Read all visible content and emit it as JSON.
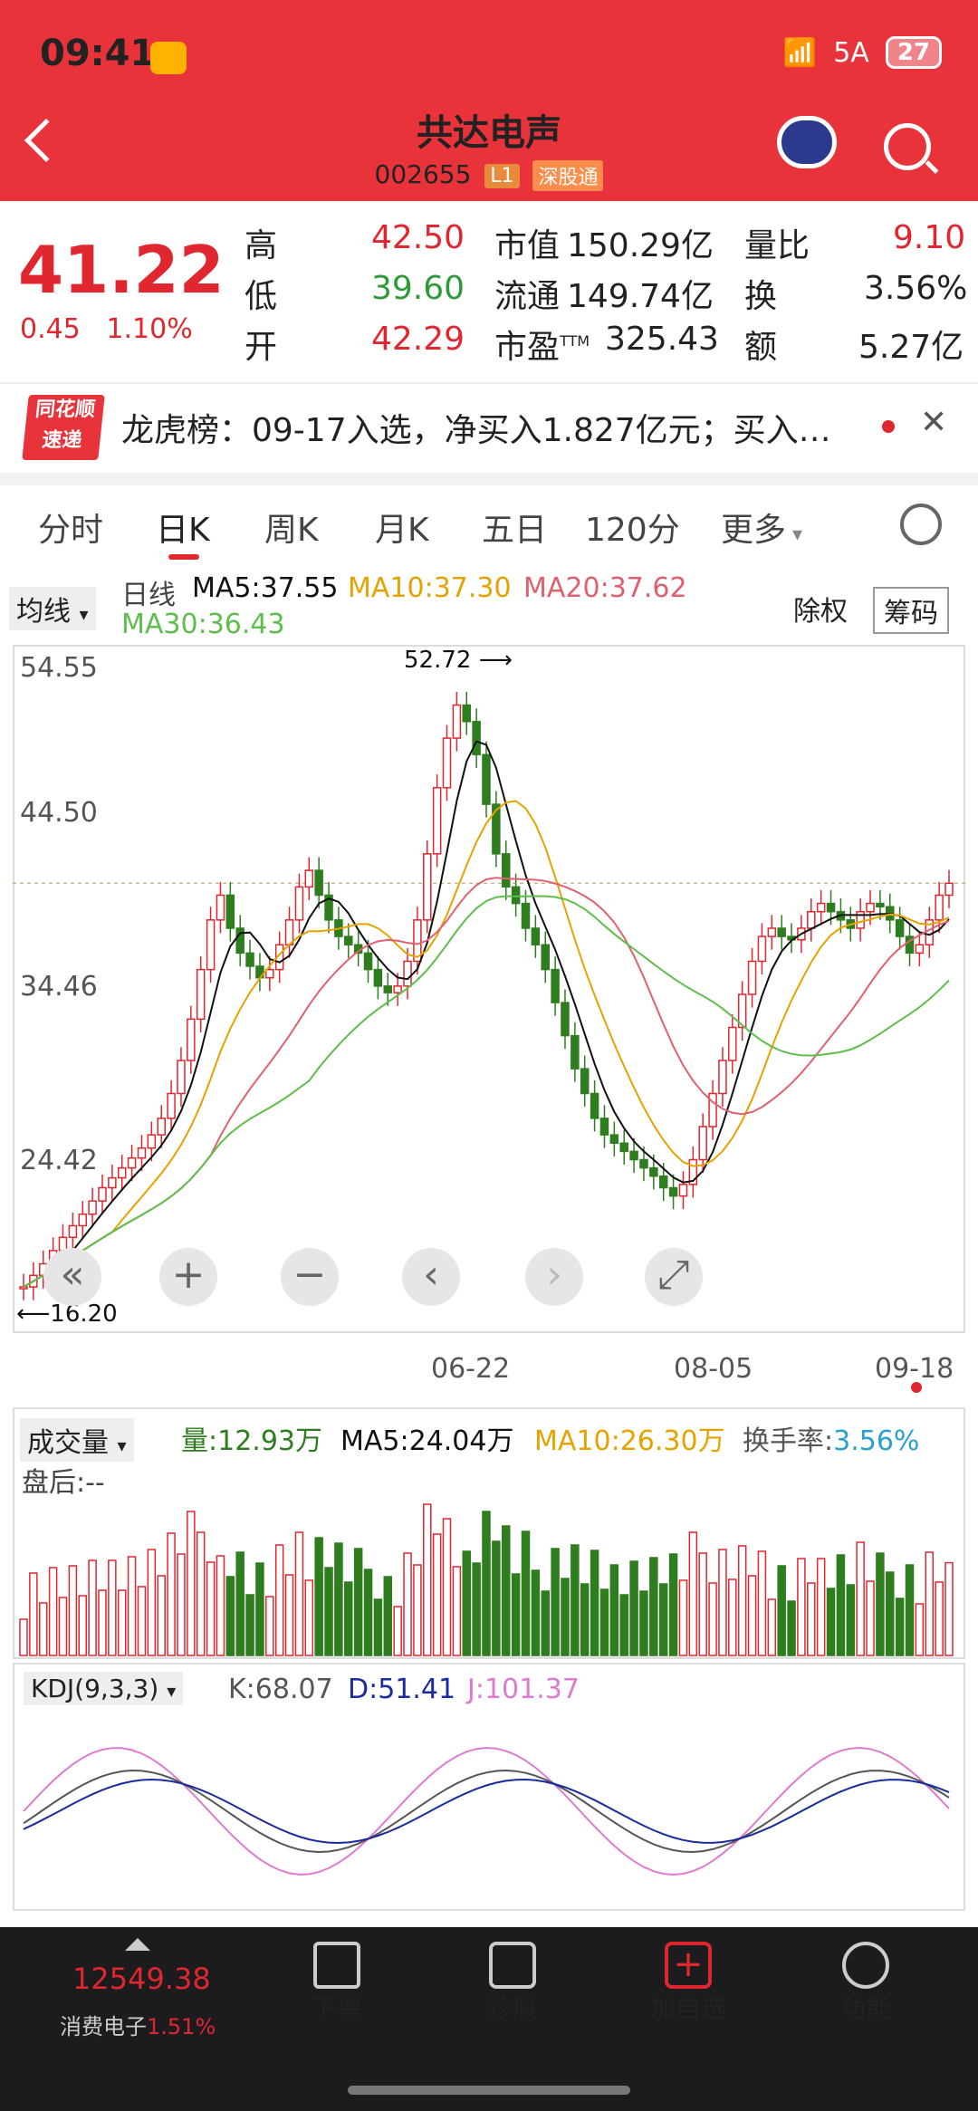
{
  "status": {
    "time": "09:41",
    "battery": "27",
    "signal": "5A"
  },
  "header": {
    "title": "共达电声",
    "code": "002655",
    "level_tag": "L1",
    "market_tag": "深股通"
  },
  "quote": {
    "price": "41.22",
    "change": "0.45",
    "change_pct": "1.10%",
    "high_label": "高",
    "high": "42.50",
    "low_label": "低",
    "low": "39.60",
    "open_label": "开",
    "open": "42.29",
    "mcap_label": "市值",
    "mcap": "150.29亿",
    "float_label": "流通",
    "float": "149.74亿",
    "pe_label": "市盈",
    "pe_sup": "TTM",
    "pe": "325.43",
    "vr_label": "量比",
    "vr": "9.10",
    "turn_label": "换",
    "turn": "3.56%",
    "amt_label": "额",
    "amt": "5.27亿"
  },
  "news": {
    "logo_top": "同花顺",
    "logo_bottom": "速递",
    "text": "龙虎榜：09-17入选，净买入1.827亿元；买入…"
  },
  "tabs": [
    "分时",
    "日K",
    "周K",
    "月K",
    "五日",
    "120分",
    "更多"
  ],
  "ma": {
    "selector": "均线",
    "period": "日线",
    "ma5": "MA5:37.55",
    "ma10": "MA10:37.30",
    "ma20": "MA20:37.62",
    "ma30": "MA30:36.43",
    "adjust": "除权",
    "chips": "筹码"
  },
  "kchart": {
    "y_labels": [
      "54.55",
      "44.50",
      "34.46",
      "24.42"
    ],
    "high_mark": "52.72",
    "low_mark": "16.20",
    "x_labels": [
      "06-22",
      "08-05",
      "09-18"
    ]
  },
  "volume": {
    "selector": "成交量",
    "vol": "量:12.93万",
    "ma5": "MA5:24.04万",
    "ma10": "MA10:26.30万",
    "turnover_label": "换手率:",
    "turnover": "3.56%",
    "after": "盘后:--"
  },
  "kdj": {
    "selector": "KDJ(9,3,3)",
    "k": "K:68.07",
    "d": "D:51.41",
    "j": "J:101.37"
  },
  "bottom": {
    "index": "12549.38",
    "sector": "消费电子",
    "sector_pct": "1.51%",
    "order": "下单",
    "diagnose": "诊股",
    "add": "加自选",
    "func": "功能"
  },
  "colors": {
    "brand": "#e8333b",
    "up": "#e0262e",
    "down": "#2e7d1e",
    "ma5": "#111111",
    "ma10": "#e6a300",
    "ma20": "#e06070",
    "ma30": "#5dbf4a",
    "kdj_k": "#555555",
    "kdj_d": "#1a2aa0",
    "kdj_j": "#e07ad0"
  },
  "chart_data": {
    "type": "candlestick",
    "y_range": [
      16.2,
      54.55
    ],
    "x_ticks": [
      "06-22",
      "08-05",
      "09-18"
    ],
    "high_annotation": 52.72,
    "low_annotation": 16.2,
    "close_path": [
      16.8,
      17.5,
      18.2,
      19,
      19.8,
      20.5,
      21.2,
      22,
      22.8,
      23.4,
      24,
      24.6,
      25.2,
      26,
      27,
      28.5,
      30.5,
      33,
      36,
      39,
      40.5,
      38.5,
      37,
      36.2,
      35.5,
      36,
      37.5,
      39,
      41,
      42,
      40.5,
      39,
      38,
      37.5,
      37,
      36,
      35,
      34.6,
      35,
      36.5,
      39,
      43,
      47,
      50,
      52,
      51,
      49,
      46,
      43,
      41,
      40,
      38.5,
      37.5,
      36,
      34,
      32,
      30,
      28.5,
      27,
      26,
      25.5,
      25,
      24.5,
      24,
      23.5,
      22.8,
      22.3,
      23,
      24.5,
      26.5,
      28.5,
      30.5,
      32.5,
      34.5,
      36.5,
      38,
      38.5,
      38,
      37.8,
      38.5,
      39.5,
      40,
      39.5,
      39,
      38.5,
      39.5,
      40,
      39.8,
      39,
      38,
      37,
      37.5,
      39,
      40.5,
      41.22
    ]
  }
}
